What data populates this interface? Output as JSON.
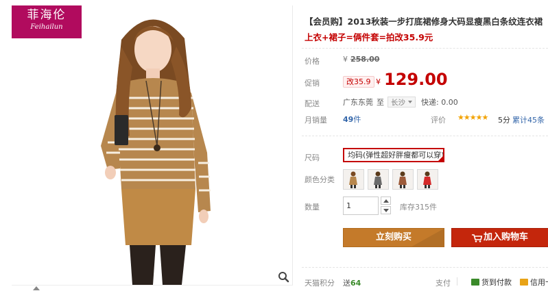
{
  "brand": {
    "name_cn": "菲海伦",
    "name_en": "Feihailun"
  },
  "product": {
    "title": "【会员购】2013秋装一步打底裙修身大码显瘦黑白条纹连衣裙",
    "promo_text": "上衣+裙子=俩件套=拍改35.9元"
  },
  "price": {
    "label": "价格",
    "currency": "¥",
    "original": "258.00",
    "promo_label": "促销",
    "promo_badge": "改35.9",
    "promo_currency": "¥",
    "promo_value": "129.00"
  },
  "delivery": {
    "label": "配送",
    "from": "广东东莞",
    "to_word": "至",
    "to_city": "长沙",
    "shipping": "快递: 0.00"
  },
  "sales": {
    "label": "月销量",
    "count": "49",
    "unit": "件",
    "rating_label": "评价",
    "stars": 5,
    "score": "5分",
    "total": "累计45条"
  },
  "options": {
    "size_label": "尺码",
    "size_value": "均码(弹性超好胖瘦都可以穿)",
    "color_label": "颜色分类",
    "colors": [
      {
        "name": "khaki",
        "hex": "#b7874e"
      },
      {
        "name": "gray",
        "hex": "#6b6b6b"
      },
      {
        "name": "camel",
        "hex": "#9c5a3a"
      },
      {
        "name": "red",
        "hex": "#d42a2a"
      }
    ]
  },
  "quantity": {
    "label": "数量",
    "value": "1",
    "stock": "库存315件"
  },
  "actions": {
    "buy_now": "立刻购买",
    "add_cart": "加入购物车"
  },
  "footer": {
    "points_label": "天猫积分",
    "points_prefix": "送",
    "points_value": "64",
    "pay_label": "支付",
    "pay_cod": "货到付款",
    "pay_credit": "信用卡"
  },
  "colors": {
    "accent_red": "#c40000",
    "buy_now_bg": "#c47a2a",
    "add_cart_bg": "#c4260c",
    "brand_bg": "#b10b5e",
    "sweater": "#b7874e"
  }
}
